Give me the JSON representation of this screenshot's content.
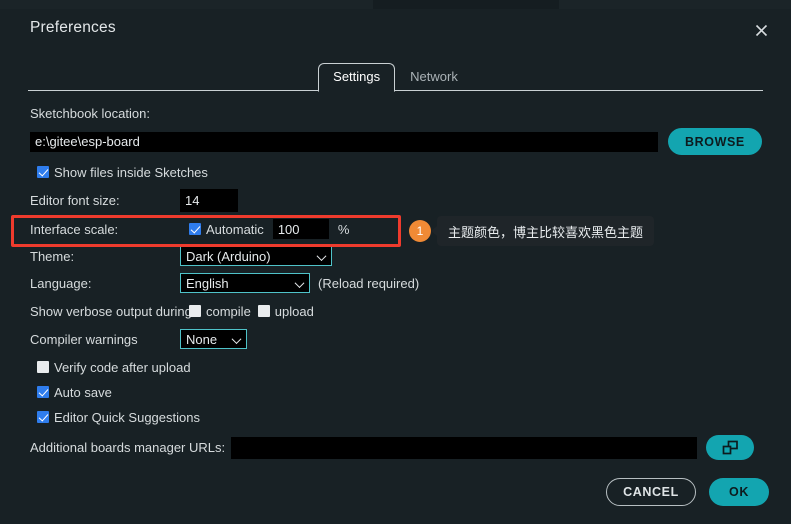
{
  "dialog": {
    "title": "Preferences",
    "close_icon": "close-icon"
  },
  "tabs": [
    {
      "label": "Settings",
      "active": true
    },
    {
      "label": "Network",
      "active": false
    }
  ],
  "settings": {
    "sketchbook": {
      "label": "Sketchbook location:",
      "value": "e:\\gitee\\esp-board",
      "browse_label": "BROWSE"
    },
    "show_files_inside_sketches": {
      "label": "Show files inside Sketches",
      "checked": true
    },
    "editor_font_size": {
      "label": "Editor font size:",
      "value": "14"
    },
    "interface_scale": {
      "label": "Interface scale:",
      "automatic_label": "Automatic",
      "automatic_checked": true,
      "value": "100",
      "unit": "%"
    },
    "theme": {
      "label": "Theme:",
      "value": "Dark (Arduino)"
    },
    "language": {
      "label": "Language:",
      "value": "English",
      "note": "(Reload required)"
    },
    "verbose_output": {
      "label": "Show verbose output during",
      "compile_label": "compile",
      "compile_checked": false,
      "upload_label": "upload",
      "upload_checked": false
    },
    "compiler_warnings": {
      "label": "Compiler warnings",
      "value": "None"
    },
    "verify_code": {
      "label": "Verify code after upload",
      "checked": false
    },
    "auto_save": {
      "label": "Auto save",
      "checked": true
    },
    "editor_quick_suggestions": {
      "label": "Editor Quick Suggestions",
      "checked": true
    },
    "additional_urls": {
      "label": "Additional boards manager URLs:",
      "value": "",
      "edit_icon": "external-window-icon"
    }
  },
  "annotation": {
    "badge_number": "1",
    "tooltip_text": "主题颜色，博主比较喜欢黑色主题",
    "highlight_color": "#ef3b2d",
    "badge_color": "#f08a35"
  },
  "footer": {
    "cancel_label": "CANCEL",
    "ok_label": "OK"
  },
  "colors": {
    "background": "#182125",
    "accent": "#13a5b0",
    "input_background": "#000000",
    "input_border": "#4fc3c9",
    "checkbox_on": "#2f7ded"
  }
}
